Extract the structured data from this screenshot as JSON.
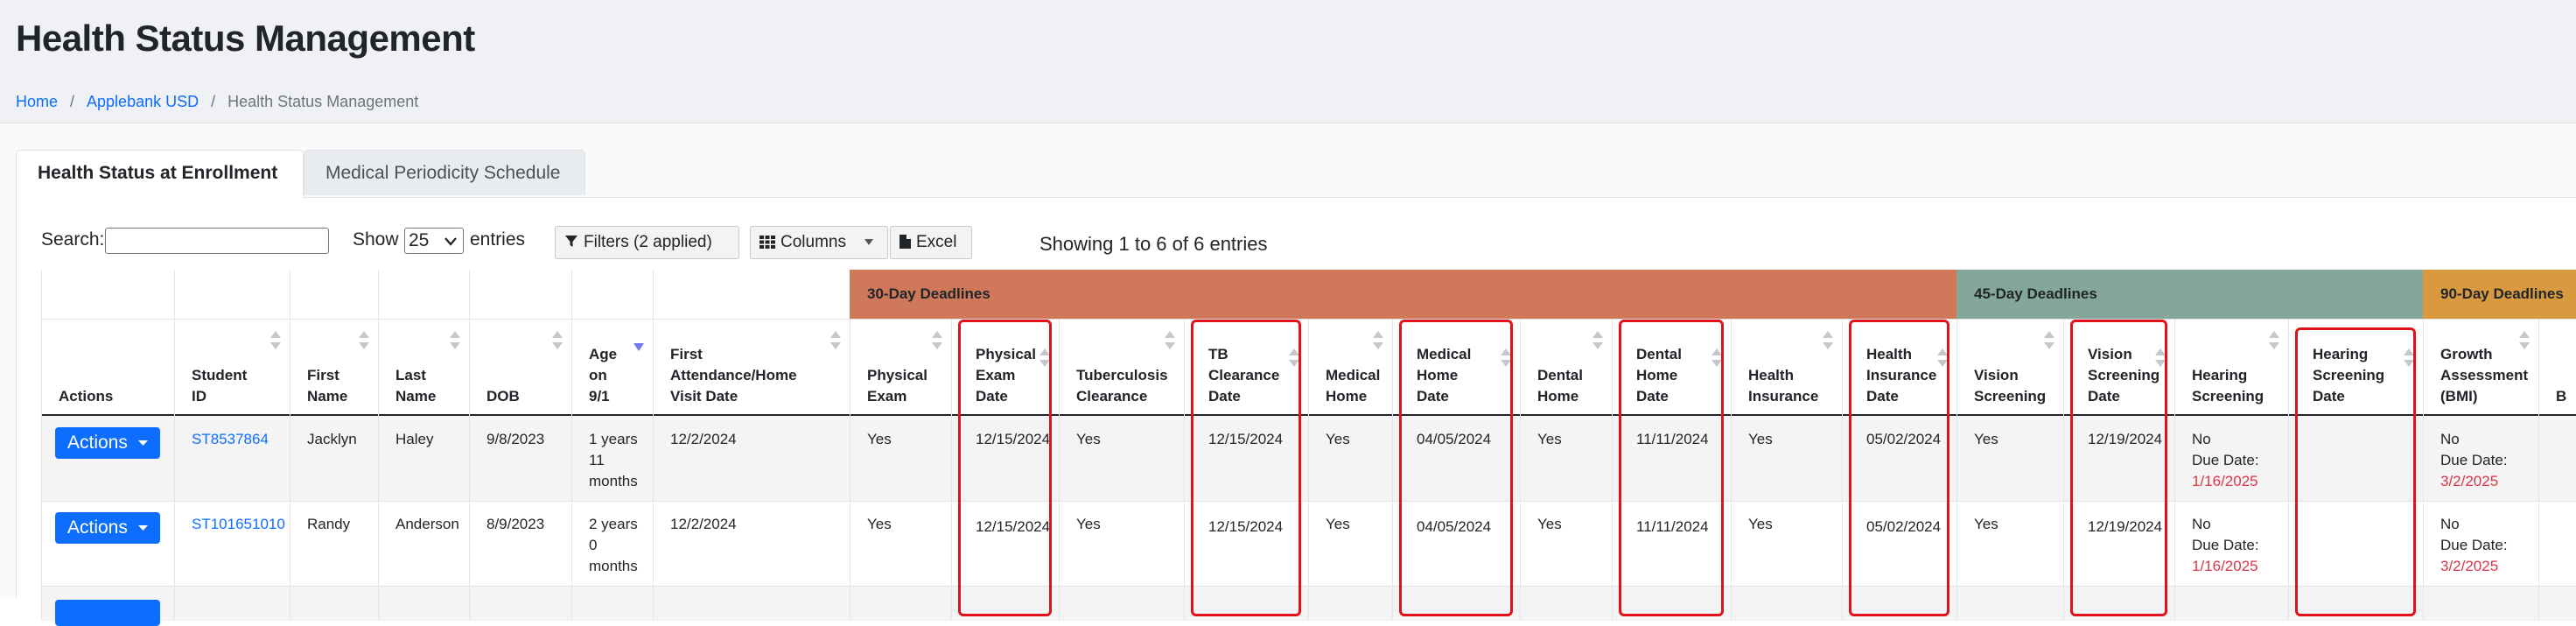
{
  "page": {
    "title": "Health Status Management"
  },
  "breadcrumb": {
    "home": "Home",
    "district": "Applebank USD",
    "current": "Health Status Management",
    "separator": "/"
  },
  "tabs": [
    {
      "label": "Health Status at Enrollment",
      "active": true
    },
    {
      "label": "Medical Periodicity Schedule",
      "active": false
    }
  ],
  "controls": {
    "search_label": "Search:",
    "search_value": "",
    "show_label": "Show",
    "entries_value": "25",
    "entries_label": "entries",
    "filters_label": "Filters (2 applied)",
    "columns_label": "Columns",
    "excel_label": "Excel",
    "showing_text": "Showing 1 to 6 of 6 entries"
  },
  "bands": [
    {
      "label": "30-Day Deadlines",
      "color": "#d0785a"
    },
    {
      "label": "45-Day Deadlines",
      "color": "#84a79a"
    },
    {
      "label": "90-Day Deadlines",
      "color": "#d99a3f"
    }
  ],
  "columns": [
    {
      "key": "actions",
      "lines": [
        "Actions"
      ]
    },
    {
      "key": "student_id",
      "lines": [
        "Student",
        "ID"
      ]
    },
    {
      "key": "first_name",
      "lines": [
        "First",
        "Name"
      ]
    },
    {
      "key": "last_name",
      "lines": [
        "Last",
        "Name"
      ]
    },
    {
      "key": "dob",
      "lines": [
        "DOB"
      ]
    },
    {
      "key": "age",
      "lines": [
        "Age",
        "on",
        "9/1"
      ]
    },
    {
      "key": "first_attendance",
      "lines": [
        "First",
        "Attendance/Home",
        "Visit Date"
      ]
    },
    {
      "key": "physical_exam",
      "lines": [
        "Physical",
        "Exam"
      ]
    },
    {
      "key": "physical_exam_date",
      "lines": [
        "Physical",
        "Exam",
        "Date"
      ]
    },
    {
      "key": "tb_clearance",
      "lines": [
        "Tuberculosis",
        "Clearance"
      ]
    },
    {
      "key": "tb_clearance_date",
      "lines": [
        "TB",
        "Clearance",
        "Date"
      ]
    },
    {
      "key": "medical_home",
      "lines": [
        "Medical",
        "Home"
      ]
    },
    {
      "key": "medical_home_date",
      "lines": [
        "Medical",
        "Home",
        "Date"
      ]
    },
    {
      "key": "dental_home",
      "lines": [
        "Dental",
        "Home"
      ]
    },
    {
      "key": "dental_home_date",
      "lines": [
        "Dental",
        "Home",
        "Date"
      ]
    },
    {
      "key": "health_insurance",
      "lines": [
        "Health",
        "Insurance"
      ]
    },
    {
      "key": "health_insurance_date",
      "lines": [
        "Health",
        "Insurance",
        "Date"
      ]
    },
    {
      "key": "vision_screening",
      "lines": [
        "Vision",
        "Screening"
      ]
    },
    {
      "key": "vision_screening_date",
      "lines": [
        "Vision",
        "Screening",
        "Date"
      ]
    },
    {
      "key": "hearing_screening",
      "lines": [
        "Hearing",
        "Screening"
      ]
    },
    {
      "key": "hearing_screening_date",
      "lines": [
        "Hearing",
        "Screening",
        "Date"
      ]
    },
    {
      "key": "growth_assessment",
      "lines": [
        "Growth",
        "Assessment",
        "(BMI)"
      ]
    },
    {
      "key": "partial",
      "lines": [
        "B"
      ]
    }
  ],
  "actions_label": "Actions",
  "rows": [
    {
      "student_id": "ST8537864",
      "first_name": "Jacklyn",
      "last_name": "Haley",
      "dob": "9/8/2023",
      "age": [
        "1 years",
        "11",
        "months"
      ],
      "first_attendance": "12/2/2024",
      "physical_exam": "Yes",
      "physical_exam_date": "12/15/2024",
      "tb_clearance": "Yes",
      "tb_clearance_date": "12/15/2024",
      "medical_home": "Yes",
      "medical_home_date": "04/05/2024",
      "dental_home": "Yes",
      "dental_home_date": "11/11/2024",
      "health_insurance": "Yes",
      "health_insurance_date": "05/02/2024",
      "vision_screening": "Yes",
      "vision_screening_date": "12/19/2024",
      "hearing_screening": {
        "status": "No",
        "due_label": "Due Date:",
        "due_date": "1/16/2025"
      },
      "hearing_screening_date": "",
      "growth_assessment": {
        "status": "No",
        "due_label": "Due Date:",
        "due_date": "3/2/2025"
      }
    },
    {
      "student_id": "ST101651010",
      "first_name": "Randy",
      "last_name": "Anderson",
      "dob": "8/9/2023",
      "age": [
        "2 years",
        "0",
        "months"
      ],
      "first_attendance": "12/2/2024",
      "physical_exam": "Yes",
      "physical_exam_date": "12/15/2024",
      "tb_clearance": "Yes",
      "tb_clearance_date": "12/15/2024",
      "medical_home": "Yes",
      "medical_home_date": "04/05/2024",
      "dental_home": "Yes",
      "dental_home_date": "11/11/2024",
      "health_insurance": "Yes",
      "health_insurance_date": "05/02/2024",
      "vision_screening": "Yes",
      "vision_screening_date": "12/19/2024",
      "hearing_screening": {
        "status": "No",
        "due_label": "Due Date:",
        "due_date": "1/16/2025"
      },
      "hearing_screening_date": "",
      "growth_assessment": {
        "status": "No",
        "due_label": "Due Date:",
        "due_date": "3/2/2025"
      }
    }
  ]
}
